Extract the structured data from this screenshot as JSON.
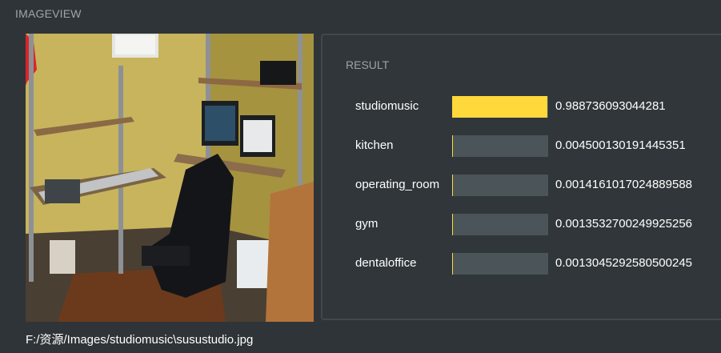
{
  "header": {
    "title": "IMAGEVIEW"
  },
  "image": {
    "alt": "studio photo",
    "path": "F:/资源/Images/studiomusic\\susustudio.jpg"
  },
  "result": {
    "title": "RESULT",
    "accent_color": "#ffd83b",
    "track_color": "#4a5459",
    "items": [
      {
        "label": "studiomusic",
        "value": "0.988736093044281",
        "score": 0.988736093044281
      },
      {
        "label": "kitchen",
        "value": "0.004500130191445351",
        "score": 0.004500130191445351
      },
      {
        "label": "operating_room",
        "value": "0.0014161017024889588",
        "score": 0.0014161017024889588
      },
      {
        "label": "gym",
        "value": "0.0013532700249925256",
        "score": 0.0013532700249925256
      },
      {
        "label": "dentaloffice",
        "value": "0.0013045292580500245",
        "score": 0.0013045292580500245
      }
    ]
  }
}
